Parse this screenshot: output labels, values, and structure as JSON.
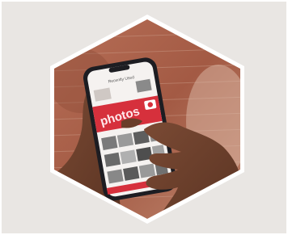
{
  "image": {
    "subject": "hands holding a smartphone showing a photos app",
    "colors": {
      "frame_bg": "#e9e6e3",
      "hex_border": "#ffffff",
      "brick": "#a86048",
      "skin": "#6b3f2c",
      "phone_body": "#1d1d22",
      "app_red": "#d6303c",
      "banner_red": "#e0505a"
    }
  },
  "screen": {
    "header_title": "Recently Used",
    "banner_text": "photos",
    "banner_icon": "camera-icon"
  }
}
